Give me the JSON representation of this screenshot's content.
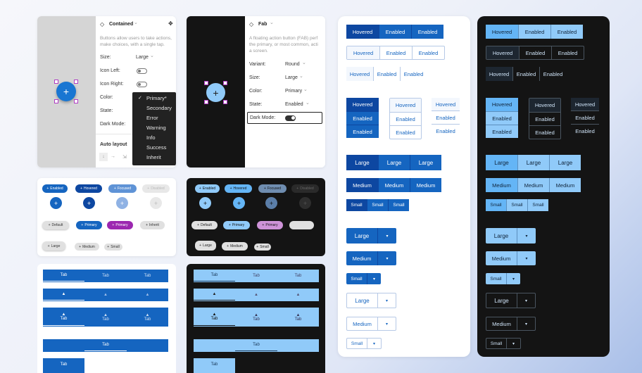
{
  "props_light": {
    "component": "Contained",
    "desc1": "Buttons allow users to take actions,",
    "desc2": "make choices, with a single tap.",
    "rows": [
      {
        "label": "Size:",
        "value": "Large"
      },
      {
        "label": "Icon Left:"
      },
      {
        "label": "Icon Right:"
      },
      {
        "label": "Color:"
      },
      {
        "label": "State:"
      },
      {
        "label": "Dark Mode:"
      }
    ],
    "auto_layout": "Auto layout",
    "dropdown": [
      "Primary*",
      "Secondary",
      "Error",
      "Warning",
      "Info",
      "Success",
      "Inherit"
    ]
  },
  "props_dark": {
    "component": "Fab",
    "desc1": "A floating action button (FAB) perf",
    "desc2": "the primary, or most common, acti",
    "desc3": "a screen.",
    "rows": [
      {
        "label": "Variant:",
        "value": "Round"
      },
      {
        "label": "Size:",
        "value": "Large"
      },
      {
        "label": "Color:",
        "value": "Primary"
      },
      {
        "label": "State:",
        "value": "Enabled"
      },
      {
        "label": "Dark Mode:"
      }
    ]
  },
  "icons": {
    "plus": "+",
    "diamond": "◇",
    "move": "✥",
    "chevron": "⌄",
    "bell": "🔔",
    "caret": "▾",
    "check": "✓"
  },
  "chips": {
    "states": [
      "Enabled",
      "Hovered",
      "Focused",
      "Disabled"
    ],
    "colors": [
      "Default",
      "Primary",
      "Primary",
      "Inherit"
    ],
    "sizes": [
      "Large",
      "Medium",
      "Small"
    ]
  },
  "tabs": {
    "label": "Tab"
  },
  "groups": {
    "states": [
      "Hovered",
      "Enabled",
      "Enabled"
    ],
    "sizes": [
      "Large",
      "Medium",
      "Small"
    ]
  }
}
